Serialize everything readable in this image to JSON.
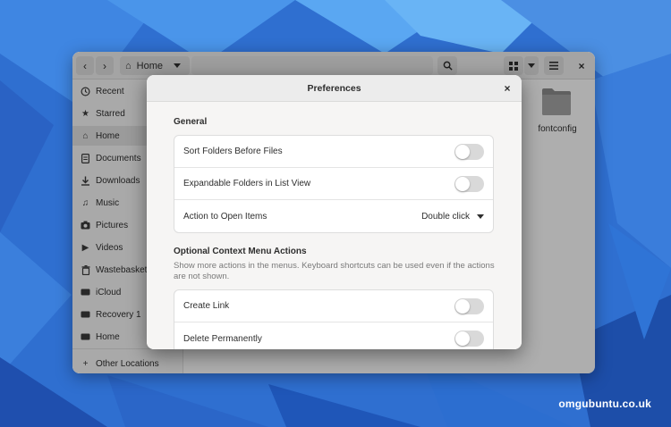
{
  "wallpaper": {
    "base_color": "#2f6fd0",
    "light_color": "#5aa7f2",
    "dark_color": "#1f4fae"
  },
  "files": {
    "headerbar": {
      "back_icon": "chevron-left-icon",
      "forward_icon": "chevron-right-icon",
      "location": "Home",
      "search_icon": "search-icon",
      "view_icon": "grid-view-icon",
      "menu_icon": "hamburger-menu-icon",
      "close_icon": "close-icon"
    },
    "sidebar": {
      "items": [
        {
          "label": "Recent",
          "icon": "clock-icon"
        },
        {
          "label": "Starred",
          "icon": "star-icon"
        },
        {
          "label": "Home",
          "icon": "home-icon"
        },
        {
          "label": "Documents",
          "icon": "document-icon"
        },
        {
          "label": "Downloads",
          "icon": "download-icon"
        },
        {
          "label": "Music",
          "icon": "music-icon"
        },
        {
          "label": "Pictures",
          "icon": "camera-icon"
        },
        {
          "label": "Videos",
          "icon": "video-icon"
        },
        {
          "label": "Wastebasket",
          "icon": "trash-icon"
        },
        {
          "label": "iCloud",
          "icon": "drive-icon"
        },
        {
          "label": "Recovery 1",
          "icon": "drive-icon"
        },
        {
          "label": "Home",
          "icon": "drive-icon"
        }
      ],
      "other_locations": "Other Locations",
      "active_index": 2
    },
    "content": {
      "folder_name": "fontconfig"
    }
  },
  "prefs": {
    "title": "Preferences",
    "general": {
      "title": "General",
      "rows": [
        {
          "label": "Sort Folders Before Files",
          "toggle": false
        },
        {
          "label": "Expandable Folders in List View",
          "toggle": false
        }
      ],
      "action_row": {
        "label": "Action to Open Items",
        "value": "Double click"
      }
    },
    "context": {
      "title": "Optional Context Menu Actions",
      "description": "Show more actions in the menus. Keyboard shortcuts can be used even if the actions are not shown.",
      "rows": [
        {
          "label": "Create Link",
          "toggle": false
        },
        {
          "label": "Delete Permanently",
          "toggle": false
        }
      ]
    }
  },
  "watermark": "omgubuntu.co.uk"
}
